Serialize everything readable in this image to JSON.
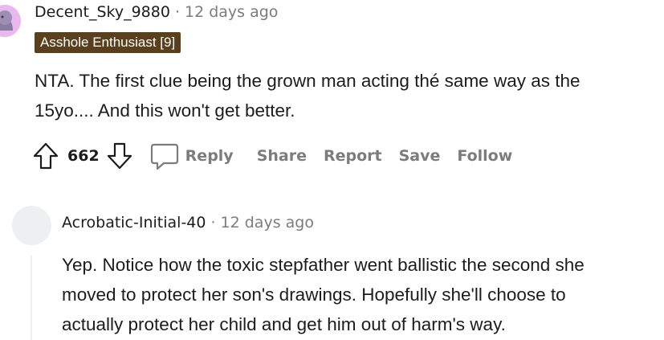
{
  "comment": {
    "author": "Decent_Sky_9880",
    "separator": "·",
    "time": "12 days ago",
    "flair": "Asshole Enthusiast [9]",
    "body_line1": "NTA. The first clue being the grown man acting thé same way as the",
    "body_line2": "15yo.... And this won't get better.",
    "votes": "662",
    "actions": {
      "reply": "Reply",
      "share": "Share",
      "report": "Report",
      "save": "Save",
      "follow": "Follow"
    }
  },
  "reply": {
    "author": "Acrobatic-Initial-40",
    "separator": "·",
    "time": "12 days ago",
    "body_line1": "Yep. Notice how the toxic stepfather went ballistic the second she",
    "body_line2": "moved to protect her son's drawings. Hopefully she'll choose to",
    "body_line3": "actually protect her child and get him out of harm's way."
  },
  "colors": {
    "flair_bg": "#5a3f1c",
    "muted_text": "#7c7c7c",
    "avatar_top": "#e9b8ec",
    "avatar_reply": "#edeff1"
  },
  "icons": [
    "upvote-icon",
    "downvote-icon",
    "comment-icon"
  ]
}
